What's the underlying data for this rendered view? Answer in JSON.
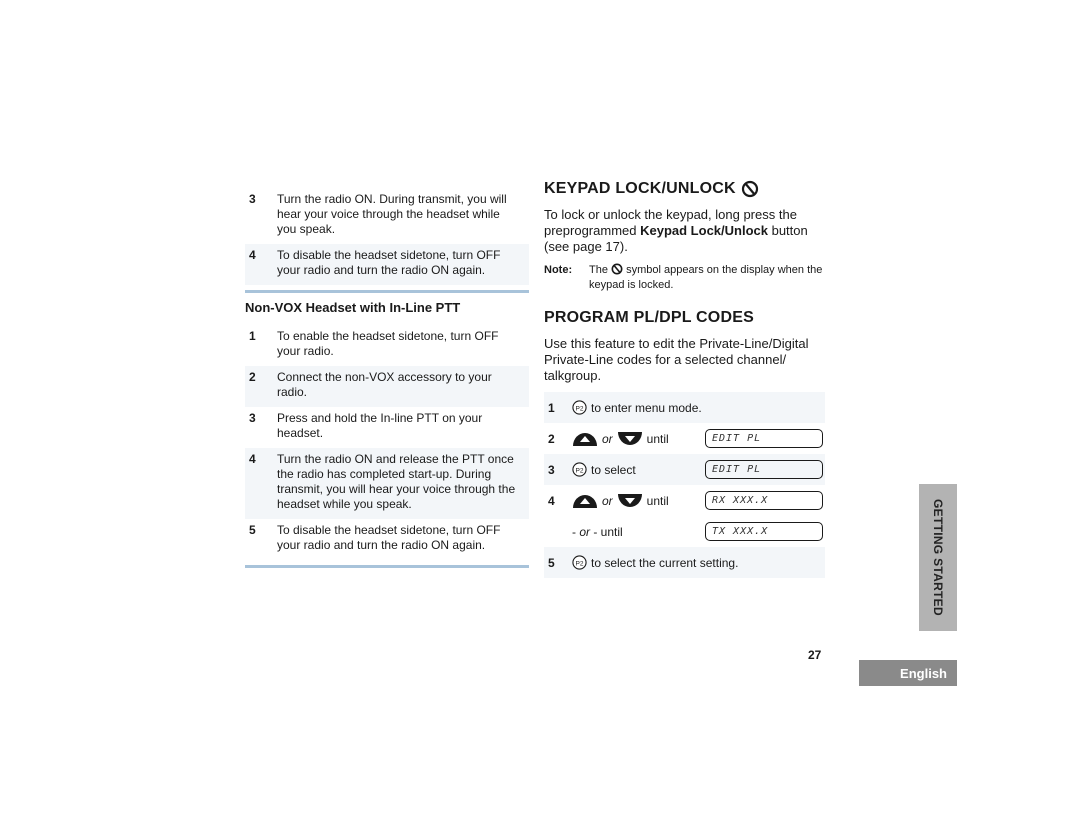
{
  "left": {
    "steps_top": [
      {
        "num": "3",
        "text": "Turn the radio ON. During transmit, you will hear your voice through the headset while you speak."
      },
      {
        "num": "4",
        "text": "To disable the headset sidetone, turn OFF your radio and turn the radio ON again."
      }
    ],
    "subheading": "Non-VOX Headset with In-Line PTT",
    "steps_bottom": [
      {
        "num": "1",
        "text": "To enable the headset sidetone, turn OFF your radio."
      },
      {
        "num": "2",
        "text": "Connect the non-VOX accessory to your radio."
      },
      {
        "num": "3",
        "text": "Press and hold the In-line PTT on your headset."
      },
      {
        "num": "4",
        "text": "Turn the radio ON and release the PTT once the radio has completed start-up. During transmit, you will hear your voice through the headset while you speak."
      },
      {
        "num": "5",
        "text": "To disable the headset sidetone, turn OFF your radio and turn the radio ON again."
      }
    ]
  },
  "right": {
    "keypad": {
      "title": "KEYPAD LOCK/UNLOCK",
      "icon": "keypad-lock-icon",
      "body_pre": "To lock or unlock the keypad, long press the preprogrammed ",
      "body_bold": "Keypad Lock/Unlock",
      "body_post": " button (see page 17).",
      "note_label": "Note:",
      "note_pre": "The ",
      "note_post": " symbol appears on the display when the keypad is locked."
    },
    "program": {
      "title": "PROGRAM PL/DPL CODES",
      "body": "Use this feature to edit the Private-Line/Digital Private-Line codes for a selected channel/ talkgroup.",
      "steps": [
        {
          "num": "1",
          "button": "P2",
          "text": "to enter menu mode."
        },
        {
          "num": "2",
          "or": "or",
          "text": "until",
          "lcd": "EDIT PL"
        },
        {
          "num": "3",
          "button": "P2",
          "text": "to select",
          "lcd": "EDIT PL"
        },
        {
          "num": "4",
          "or": "or",
          "text": "until",
          "lcd": "RX XXX.X"
        },
        {
          "num": "",
          "alt_pre": "- ",
          "alt_or": "or",
          "alt_post": " - until",
          "lcd": "TX XXX.X"
        },
        {
          "num": "5",
          "button": "P2",
          "text": "to select the current setting."
        }
      ]
    }
  },
  "side_tab": "GETTING STARTED",
  "page_number": "27",
  "language_tab": "English"
}
